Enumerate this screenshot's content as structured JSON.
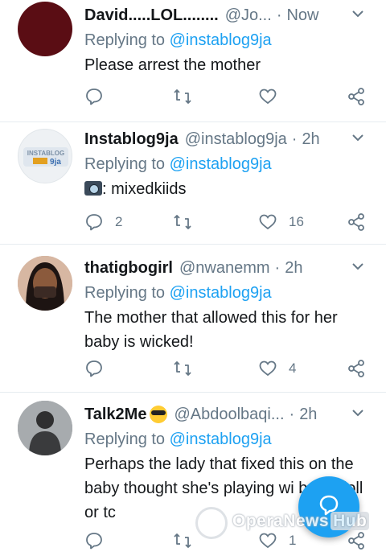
{
  "tweets": [
    {
      "name": "David.....LOL........",
      "handle": "@Jo...",
      "time": "Now",
      "replying_prefix": "Replying to",
      "replying_to": "@instablog9ja",
      "text": "Please arrest the mother",
      "reply_count": "",
      "retweet_count": "",
      "like_count": ""
    },
    {
      "name": "Instablog9ja",
      "handle": "@instablog9ja",
      "time": "2h",
      "replying_prefix": "Replying to",
      "replying_to": "@instablog9ja",
      "text": ": mixedkiids",
      "reply_count": "2",
      "retweet_count": "",
      "like_count": "16"
    },
    {
      "name": "thatigbogirl",
      "handle": "@nwanemm",
      "time": "2h",
      "replying_prefix": "Replying to",
      "replying_to": "@instablog9ja",
      "text": "The mother that allowed this for her baby is wicked!",
      "reply_count": "",
      "retweet_count": "",
      "like_count": "4"
    },
    {
      "name": "Talk2Me",
      "handle": "@Abdoolbaqi...",
      "time": "2h",
      "replying_prefix": "Replying to",
      "replying_to": "@instablog9ja",
      "text": "Perhaps the lady that fixed this on the baby thought she's playing wi baby doll or tc",
      "reply_count": "",
      "retweet_count": "",
      "like_count": "1"
    }
  ],
  "avatar_texts": {
    "instablog": "INSTABLOG",
    "instablog_sub": "9ja"
  },
  "watermark": {
    "main": "OperaNews",
    "badge": "Hub"
  },
  "colors": {
    "accent": "#1da1f2",
    "muted": "#657786",
    "text": "#14171a",
    "divider": "#e6ecf0"
  }
}
